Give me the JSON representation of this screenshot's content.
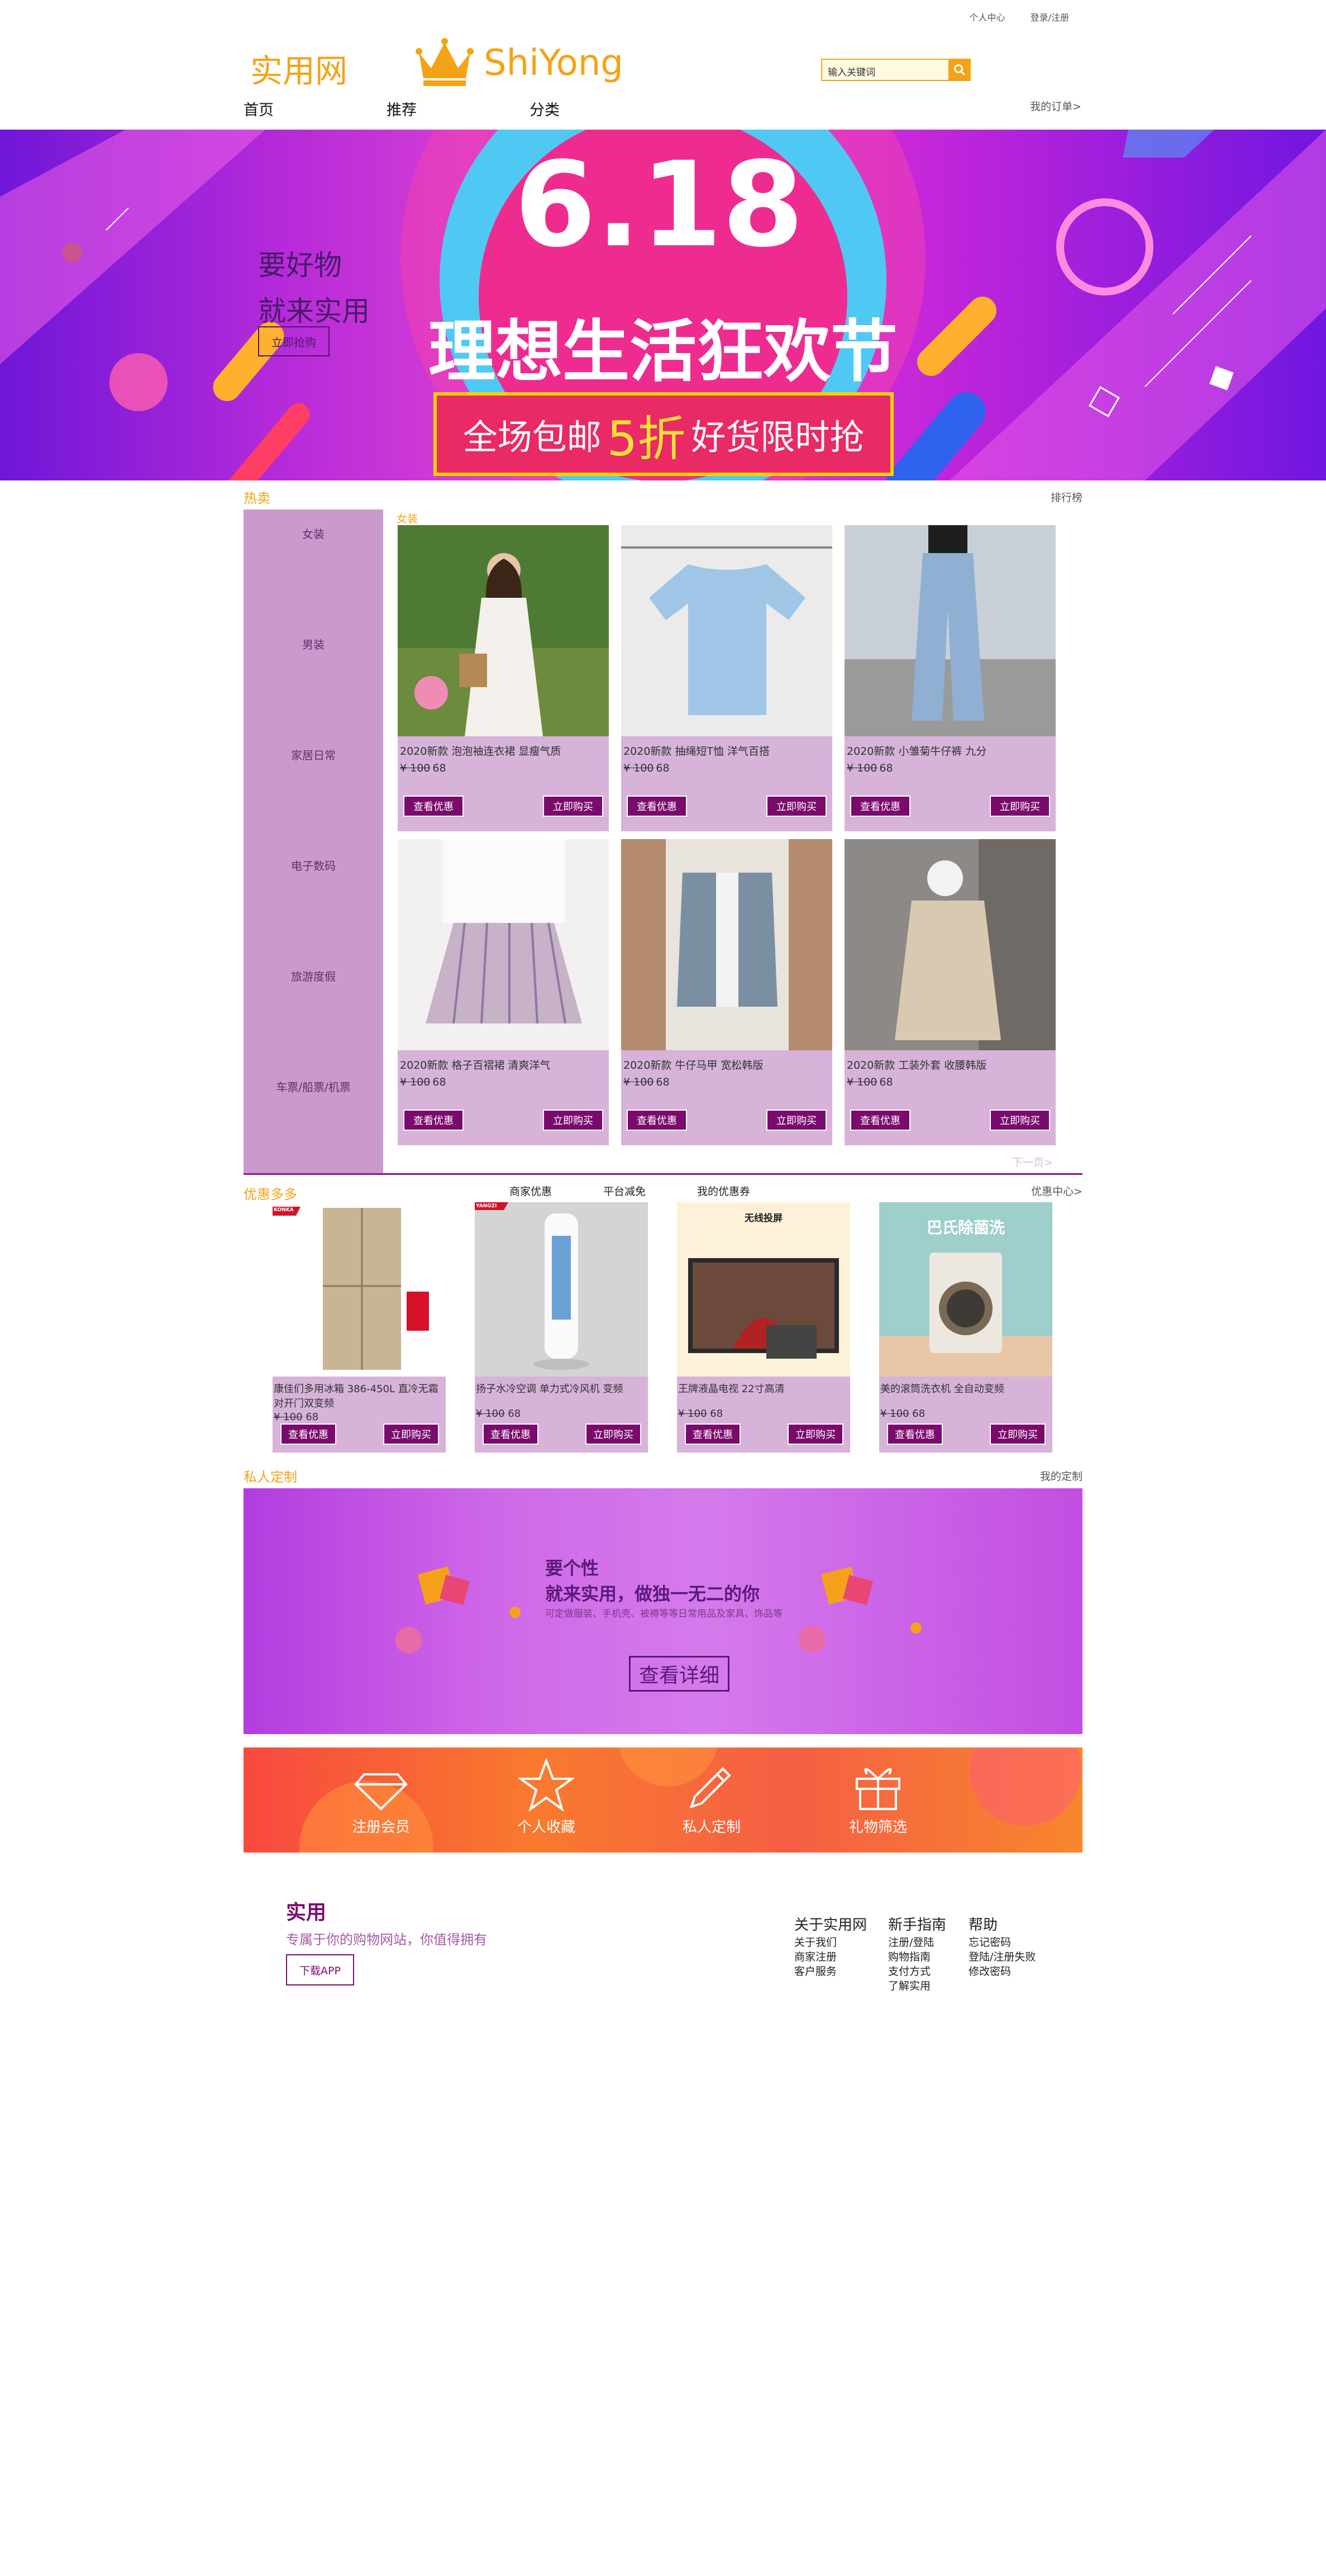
{
  "header": {
    "top_links": [
      "个人中心",
      "登录/注册"
    ],
    "logo_cn": "实用网",
    "logo_en": "ShiYong",
    "search_placeholder": "输入关键词",
    "nav": [
      "首页",
      "推荐",
      "分类"
    ],
    "my_orders": "我的订单>"
  },
  "banner": {
    "line1": "要好物",
    "line2": "就来实用",
    "button": "立即抢购",
    "badge": "6.18",
    "headline": "理想生活狂欢节",
    "sub_a": "全场包邮",
    "sub_b": "5折",
    "sub_c": "好货限时抢"
  },
  "hot": {
    "title": "热卖",
    "ranking": "排行榜",
    "active_category": "女装",
    "categories": [
      "女装",
      "男装",
      "家居日常",
      "电子数码",
      "旅游度假",
      "车票/船票/机票"
    ],
    "products": [
      {
        "name": "2020新款 泡泡袖连衣裙 显瘦气质",
        "old_price": "¥ 100",
        "price": "68"
      },
      {
        "name": "2020新款 抽绳短T恤 洋气百搭",
        "old_price": "¥ 100",
        "price": "68"
      },
      {
        "name": "2020新款 小雏菊牛仔裤 九分",
        "old_price": "¥ 100",
        "price": "68"
      },
      {
        "name": "2020新款 格子百褶裙 清爽洋气",
        "old_price": "¥ 100",
        "price": "68"
      },
      {
        "name": "2020新款 牛仔马甲 宽松韩版",
        "old_price": "¥ 100",
        "price": "68"
      },
      {
        "name": "2020新款 工装外套 收腰韩版",
        "old_price": "¥ 100",
        "price": "68"
      }
    ],
    "coupon_label": "查看优惠",
    "buy_label": "立即购买",
    "next_page": "下一页>"
  },
  "promo": {
    "title": "优惠多多",
    "tabs": [
      "商家优惠",
      "平台减免",
      "我的优惠券"
    ],
    "center": "优惠中心>",
    "items": [
      {
        "name": "康佳们多用冰箱 386-450L 直冷无霜 对开门双变频",
        "old_price": "¥ 100",
        "price": "68",
        "brand": "KONKA"
      },
      {
        "name": "扬子水冷空调 单力式冷风机 变频",
        "old_price": "¥ 100",
        "price": "68",
        "brand": "YANGZI"
      },
      {
        "name": "王牌液晶电视 22寸高清",
        "old_price": "¥ 100",
        "price": "68",
        "screen_title": "无线投屏"
      },
      {
        "name": "美的滚筒洗衣机 全自动变频",
        "old_price": "¥ 100",
        "price": "68",
        "screen_title": "巴氏除菌洗"
      }
    ]
  },
  "custom": {
    "title": "私人定制",
    "more": "我的定制",
    "head1": "要个性",
    "head2": "就来实用，做独一无二的你",
    "desc": "可定做服装、手机壳、被褥等等日常用品及家具、饰品等",
    "button": "查看详细"
  },
  "features": [
    "注册会员",
    "个人收藏",
    "私人定制",
    "礼物筛选"
  ],
  "footer": {
    "brand": "实用",
    "slogan": "专属于你的购物网站，你值得拥有",
    "app": "下载APP",
    "columns": [
      {
        "title": "关于实用网",
        "links": [
          "关于我们",
          "商家注册",
          "客户服务"
        ]
      },
      {
        "title": "新手指南",
        "links": [
          "注册/登陆",
          "购物指南",
          "支付方式",
          "了解实用"
        ]
      },
      {
        "title": "帮助",
        "links": [
          "忘记密码",
          "登陆/注册失败",
          "修改密码"
        ]
      }
    ]
  },
  "colors": {
    "accent": "#f4a316",
    "brand_purple": "#7a0b6d",
    "card_bg": "#d7b2d9",
    "sidebar": "#cc99cc"
  }
}
